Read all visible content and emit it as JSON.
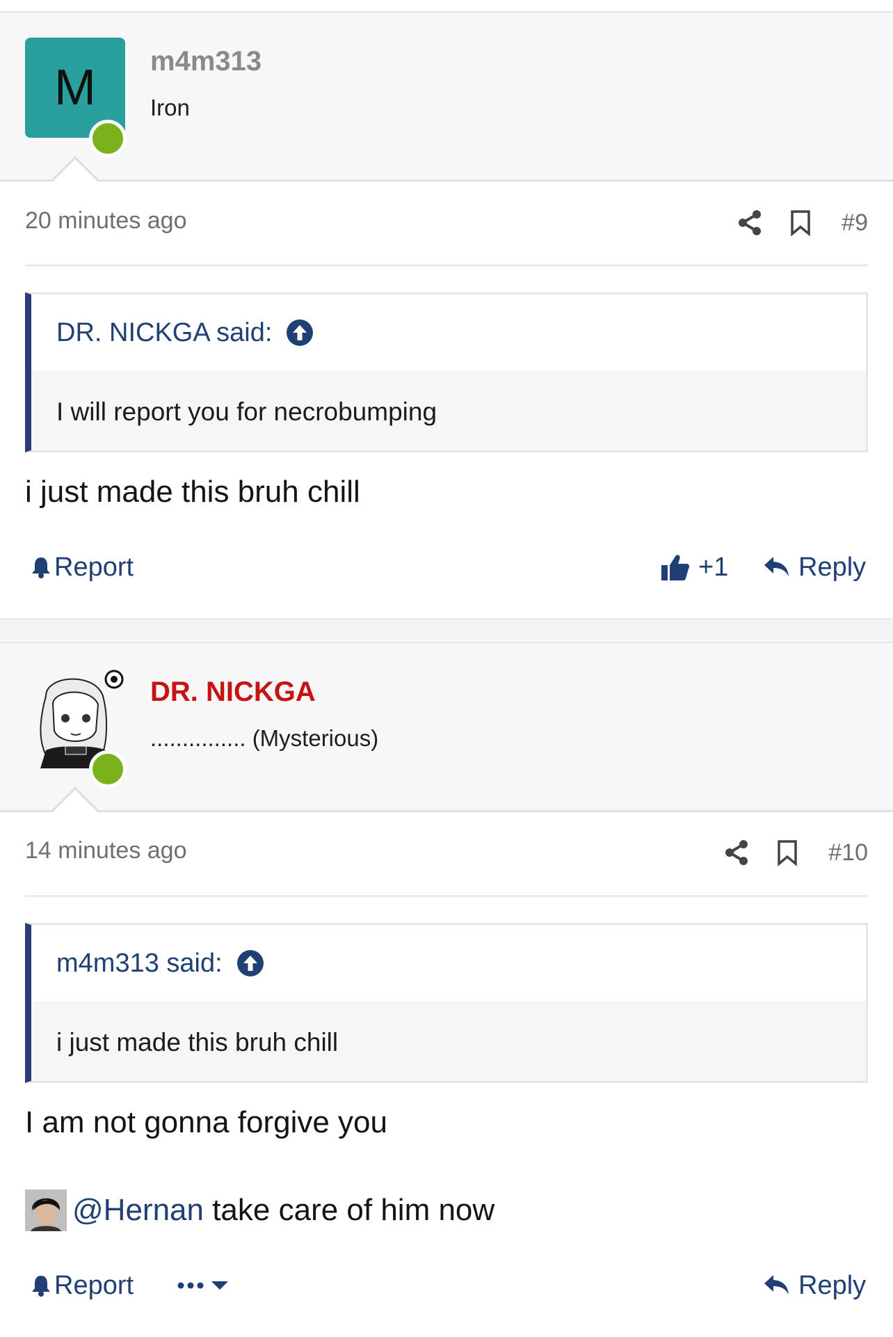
{
  "colors": {
    "link": "#1f3f75",
    "online": "#7ab21c",
    "avatar_m": "#29a09e",
    "admin_name": "#c61313",
    "muted": "#6f6f6f",
    "quote_bar": "#2b3d76"
  },
  "posts": [
    {
      "avatar_letter": "M",
      "username": "m4m313",
      "user_title": "Iron",
      "time": "20 minutes ago",
      "post_number": "#9",
      "quote": {
        "author": "DR. NICKGA said:",
        "text": "I will report you for necrobumping"
      },
      "message": "i just made this bruh chill",
      "actions": {
        "report": "Report",
        "like_count": "+1",
        "reply": "Reply"
      }
    },
    {
      "avatar_icon": "anime-avatar-image",
      "username": "DR. NICKGA",
      "user_title": "............... (Mysterious)",
      "time": "14 minutes ago",
      "post_number": "#10",
      "quote": {
        "author": "m4m313 said:",
        "text": "i just made this bruh chill"
      },
      "message": "I am not gonna forgive you",
      "mention": {
        "handle": "@Hernan",
        "text": " take care of him now"
      },
      "actions": {
        "report": "Report",
        "reply": "Reply"
      }
    }
  ]
}
